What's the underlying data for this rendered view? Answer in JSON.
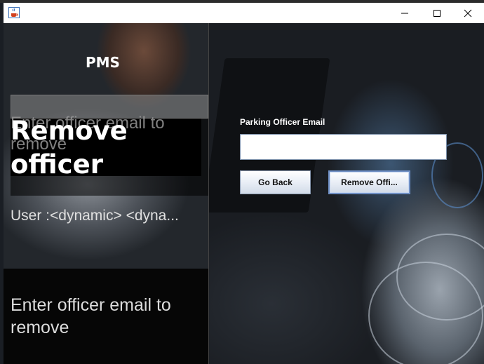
{
  "window": {
    "icon": "java-coffee-icon",
    "controls": {
      "minimize": "minimize-icon",
      "maximize": "maximize-icon",
      "close": "close-icon"
    }
  },
  "sidebar": {
    "app_name": "PMS",
    "title": "Remove officer",
    "ghost_hint": "Enter officer email to remove",
    "user_line": "User :<dynamic> <dyna...",
    "instruction": "Enter officer email to remove"
  },
  "form": {
    "email_label": "Parking Officer Email",
    "email_value": "",
    "back_button": "Go Back",
    "remove_button": "Remove Offi..."
  },
  "colors": {
    "panel_dark": "#060606",
    "button_focus_border": "#6f8fc4",
    "text_light": "#ffffff"
  }
}
